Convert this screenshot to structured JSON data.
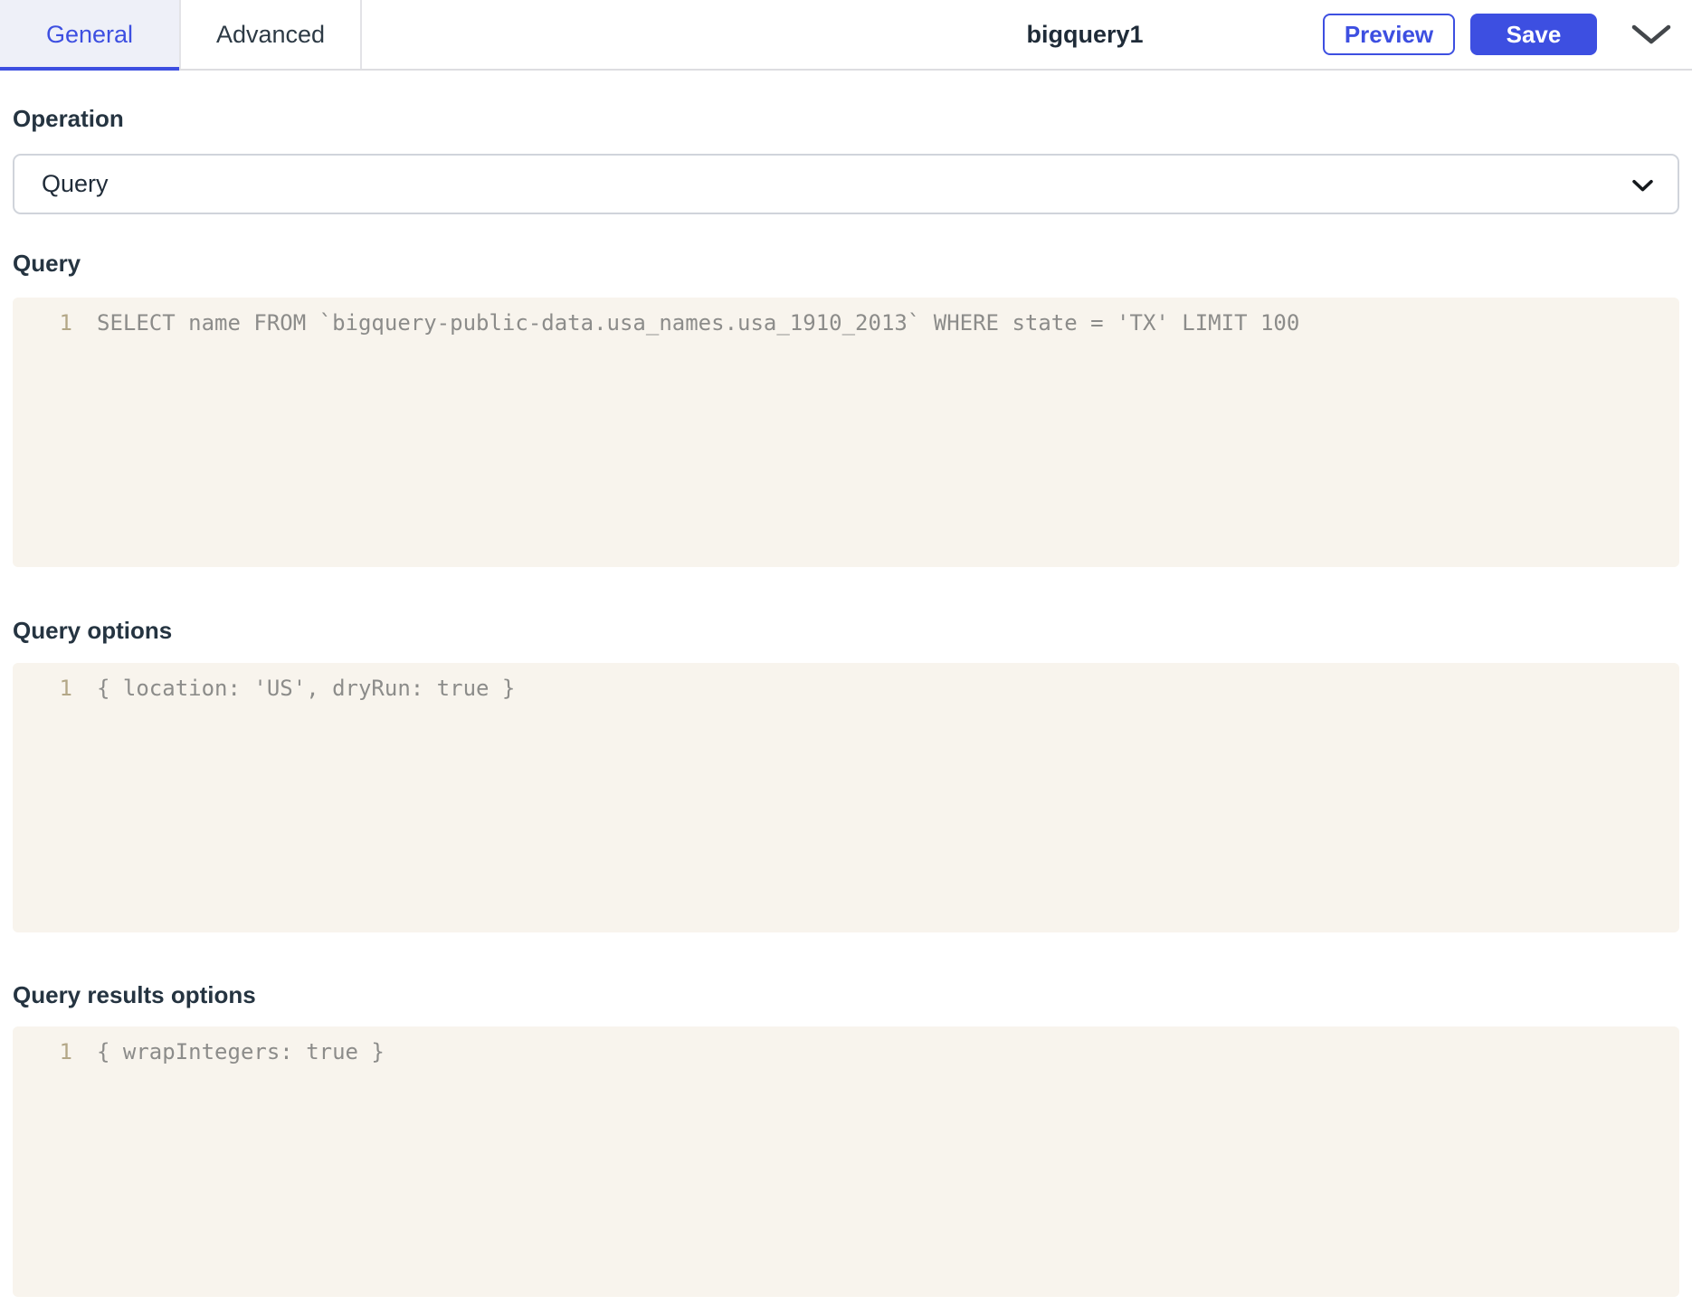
{
  "header": {
    "tabs": [
      {
        "label": "General",
        "active": true
      },
      {
        "label": "Advanced",
        "active": false
      }
    ],
    "title": "bigquery1",
    "preview_label": "Preview",
    "save_label": "Save",
    "collapse_icon": "chevron-down"
  },
  "form": {
    "operation": {
      "label": "Operation",
      "value": "Query",
      "type": "select"
    },
    "query": {
      "label": "Query",
      "type": "code",
      "lines": [
        {
          "number": "1",
          "code": "SELECT name FROM `bigquery-public-data.usa_names.usa_1910_2013` WHERE state = 'TX' LIMIT 100"
        }
      ]
    },
    "query_options": {
      "label": "Query options",
      "type": "code",
      "lines": [
        {
          "number": "1",
          "code": "{ location: 'US', dryRun: true }"
        }
      ]
    },
    "query_results_options": {
      "label": "Query results options",
      "type": "code",
      "lines": [
        {
          "number": "1",
          "code": "{ wrapIntegers: true }"
        }
      ]
    }
  },
  "colors": {
    "accent_blue": "#3d4fe1",
    "active_tab_bg": "#eef0f8",
    "editor_bg": "#f8f4ed",
    "line_number": "#b3a787",
    "code_text": "#8c8c8a",
    "label_text": "#253441",
    "header_border": "#dddde1"
  }
}
